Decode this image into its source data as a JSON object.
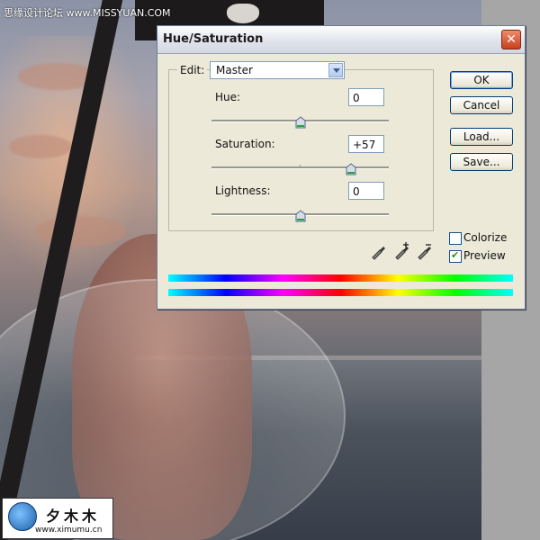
{
  "watermark": {
    "top_text": "思缘设计论坛 www.MISSYUAN.COM"
  },
  "dialog": {
    "title": "Hue/Saturation",
    "edit_label": "Edit:",
    "edit_value": "Master",
    "hue": {
      "label": "Hue:",
      "value": "0",
      "level": 0
    },
    "saturation": {
      "label": "Saturation:",
      "value": "+57",
      "level": 57
    },
    "lightness": {
      "label": "Lightness:",
      "value": "0",
      "level": 0
    },
    "buttons": {
      "ok": "OK",
      "cancel": "Cancel",
      "load": "Load...",
      "save": "Save..."
    },
    "colorize": {
      "label": "Colorize",
      "checked": false
    },
    "preview": {
      "label": "Preview",
      "checked": true
    },
    "eyedroppers": [
      "eyedropper-icon",
      "eyedropper-plus-icon",
      "eyedropper-minus-icon"
    ]
  },
  "logo": {
    "cn": "夕木木",
    "url": "www.ximumu.cn"
  }
}
